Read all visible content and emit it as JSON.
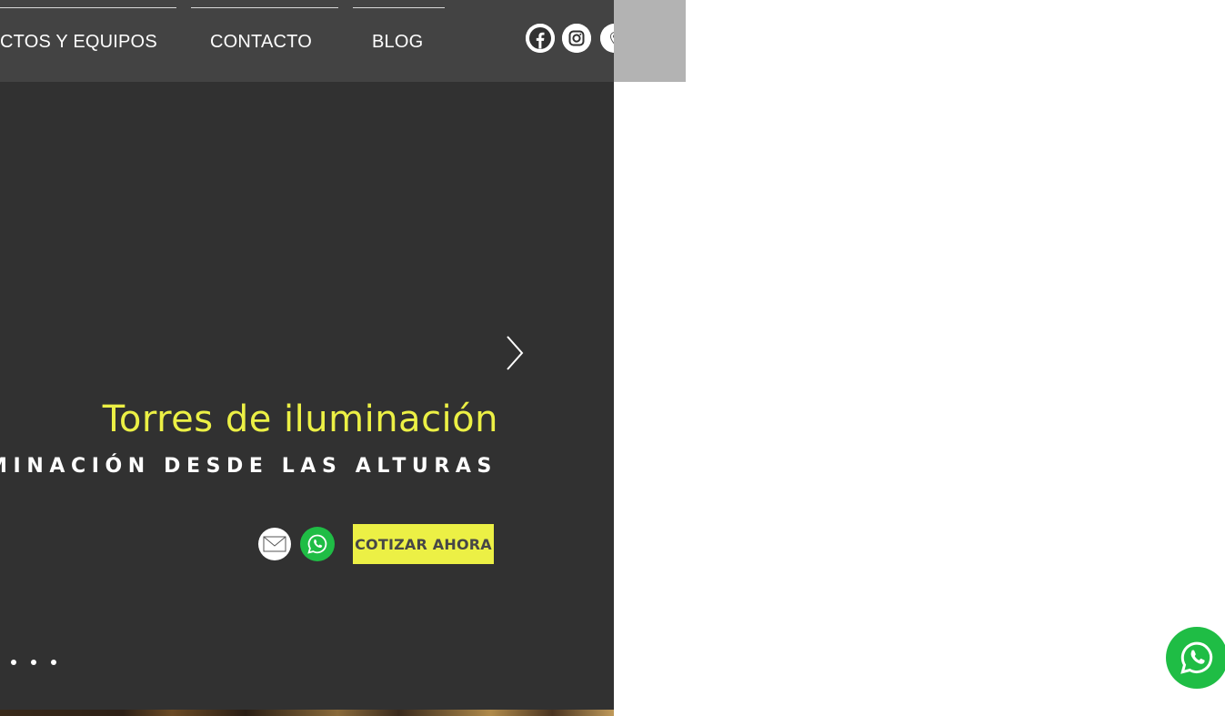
{
  "nav": {
    "items": [
      {
        "label": "CTOS Y EQUIPOS"
      },
      {
        "label": "CONTACTO"
      },
      {
        "label": "BLOG"
      }
    ]
  },
  "social": {
    "icons": [
      "facebook-icon",
      "instagram-icon",
      "map-pin-icon"
    ]
  },
  "hero": {
    "title": "Torres de iluminación",
    "subtitle": "UMINACIÓN DESDE LAS ALTURAS",
    "cta_label": "COTIZAR AHORA",
    "slides_count": 3
  },
  "colors": {
    "accent": "#ecf045",
    "hero_bg": "#313131",
    "header_bg": "#434343",
    "whatsapp": "#1fbd45"
  }
}
